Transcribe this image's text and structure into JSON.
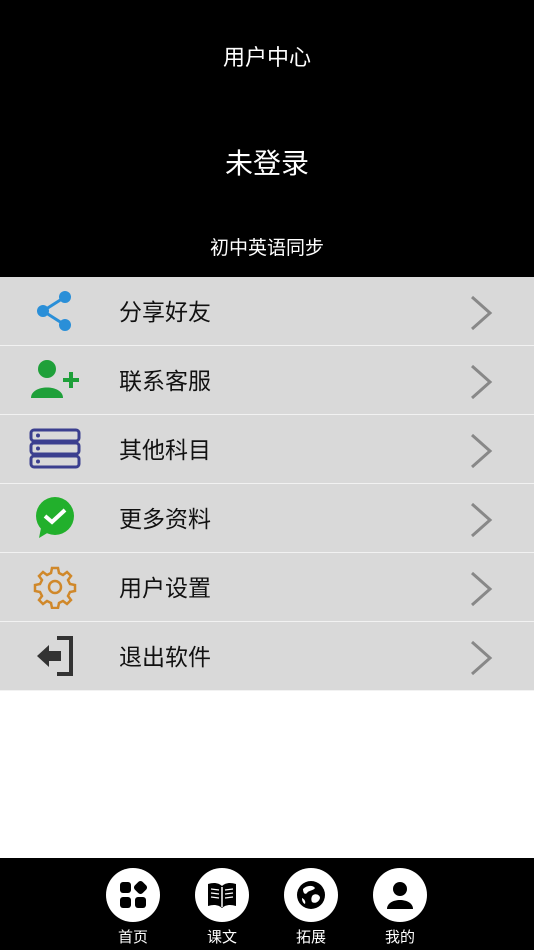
{
  "header": {
    "title": "用户中心",
    "login_status": "未登录",
    "course_name": "初中英语同步"
  },
  "menu": {
    "items": [
      {
        "label": "分享好友",
        "icon": "share-icon",
        "color": "#2a8fd8"
      },
      {
        "label": "联系客服",
        "icon": "add-user-icon",
        "color": "#1fa03a"
      },
      {
        "label": "其他科目",
        "icon": "server-list-icon",
        "color": "#3b3f8f"
      },
      {
        "label": "更多资料",
        "icon": "wechat-check-icon",
        "color": "#22b02c"
      },
      {
        "label": "用户设置",
        "icon": "gear-icon",
        "color": "#d0882a"
      },
      {
        "label": "退出软件",
        "icon": "exit-icon",
        "color": "#333333"
      }
    ]
  },
  "tabbar": {
    "tabs": [
      {
        "label": "首页",
        "icon": "home-grid-icon"
      },
      {
        "label": "课文",
        "icon": "book-icon"
      },
      {
        "label": "拓展",
        "icon": "globe-icon"
      },
      {
        "label": "我的",
        "icon": "user-icon"
      }
    ]
  },
  "colors": {
    "header_bg": "#000000",
    "menu_bg": "#d9d9d9",
    "chevron": "#888888",
    "tabbar_bg": "#000000"
  }
}
